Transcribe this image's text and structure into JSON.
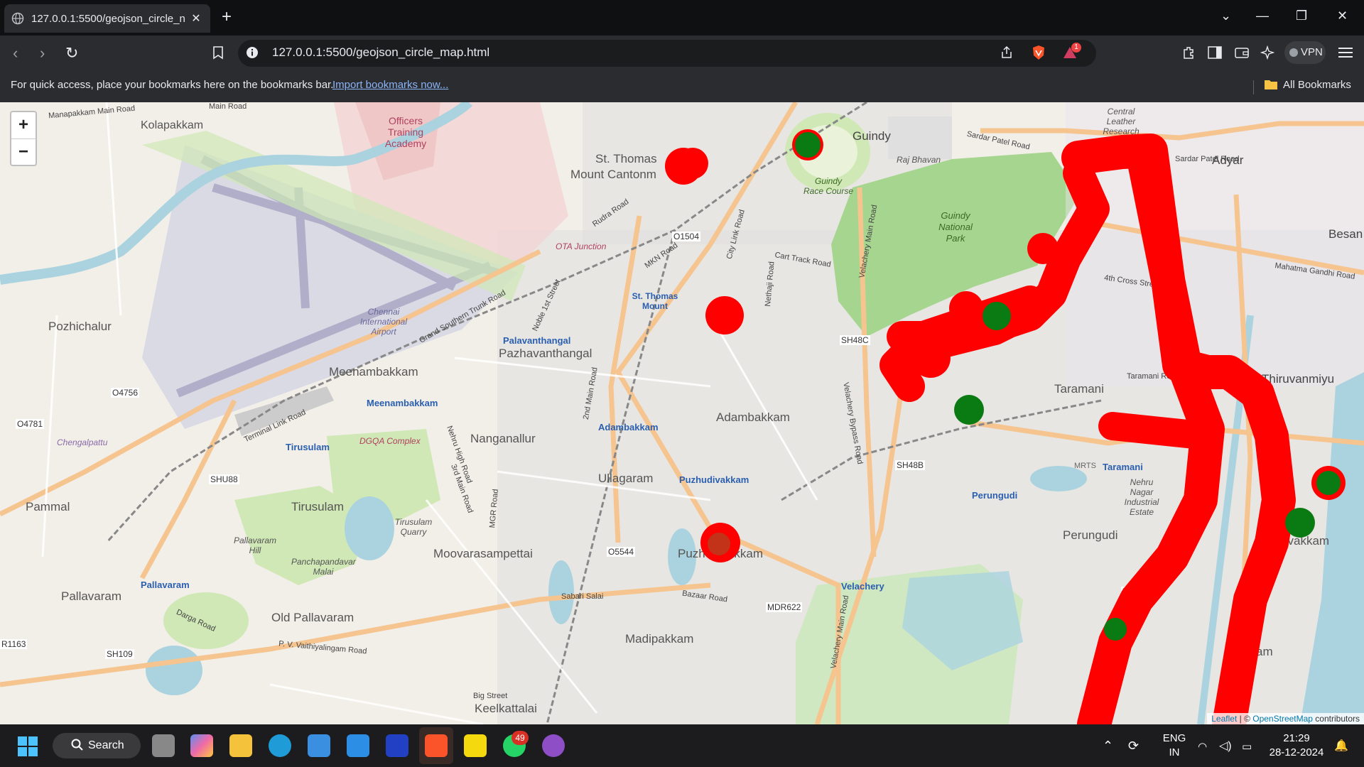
{
  "browser": {
    "tab_title": "127.0.0.1:5500/geojson_circle_n",
    "url": "127.0.0.1:5500/geojson_circle_map.html",
    "notification_count": "1",
    "vpn_label": "VPN"
  },
  "bookmarks_bar": {
    "message": "For quick access, place your bookmarks here on the bookmarks bar.",
    "import_link": "Import bookmarks now...",
    "all_bookmarks": "All Bookmarks"
  },
  "map": {
    "zoom_in": "+",
    "zoom_out": "−",
    "labels": {
      "officers": "Officers",
      "training": "Training",
      "academy": "Academy",
      "kolapakkam": "Kolapakkam",
      "guindy": "Guindy",
      "st_thomas_mount": "St. Thomas",
      "mount_cantonment": "Mount Cantonm",
      "raj_bhavan": "Raj Bhavan",
      "guindy_race": "Guindy",
      "race_course": "Race Course",
      "guindy_np1": "Guindy",
      "guindy_np2": "National",
      "guindy_np3": "Park",
      "central_leather": "Central",
      "central_leather2": "Leather",
      "central_leather3": "Research",
      "adyar": "Adyar",
      "besant": "Besan",
      "pozhichalur": "Pozhichalur",
      "chennai_airport1": "Chennai",
      "chennai_airport2": "International",
      "chennai_airport3": "Airport",
      "palavanthangal_station": "Palavanthangal",
      "pazhavanthangal": "Pazhavanthangal",
      "meenambakkam": "Meenambakkam",
      "meenambakkam_station": "Meenambakkam",
      "st_thomas_station1": "St. Thomas",
      "st_thomas_station2": "Mount",
      "o1504": "O1504",
      "ota_junction": "OTA Junction",
      "sh48c": "SH48C",
      "adambakkam_station": "Adambakkam",
      "adambakkam": "Adambakkam",
      "taramani": "Taramani",
      "thiruvanmiyur": "Thiruvanmiyu",
      "nanganallur": "Nanganallur",
      "o4756": "O4756",
      "o4781": "O4781",
      "chengalpattu": "Chengalpattu",
      "tirusulam_station": "Tirusulam",
      "dgqa": "DGQA Complex",
      "shu88": "SHU88",
      "ullagaram": "Ullagaram",
      "puzhudivakkam_station": "Puzhudivakkam",
      "sh48b": "SH48B",
      "perungudi_station": "Perungudi",
      "taramani_station": "Taramani",
      "mrts": "MRTS",
      "pammal": "Pammal",
      "tirusulam": "Tirusulam",
      "tirusulam_quarry1": "Tirusulam",
      "tirusulam_quarry2": "Quarry",
      "moovarasampettai": "Moovarasampettai",
      "o5544": "O5544",
      "puzhudivakkam": "Puzhudivakkam",
      "nehru_nagar1": "Nehru",
      "nehru_nagar2": "Nagar",
      "nehru_nagar3": "Industrial",
      "nehru_nagar4": "Estate",
      "perungudi": "Perungudi",
      "kottivakkam": "tivakkam",
      "pallavaram_hill1": "Pallavaram",
      "pallavaram_hill2": "Hill",
      "panchapandavar1": "Panchapandavar",
      "panchapandavar2": "Malai",
      "pallavaram_station": "Pallavaram",
      "pallavaram": "Pallavaram",
      "old_pallavaram": "Old Pallavaram",
      "velachery_station": "Velachery",
      "mdr622": "MDR622",
      "madipakkam": "Madipakkam",
      "sh109": "SH109",
      "r1163": "R1163",
      "keelkattalai": "Keelkattalai",
      "palli": "Pa",
      "am": "am",
      "md": "MD",
      "manapakkam_road": "Manapakkam Main Road",
      "main_road": "Main Road",
      "sardar_patel": "Sardar Patel Road",
      "sardar_patel2": "Sardar Patel Road",
      "gst_road": "Grand Southern Trunk Road",
      "velachery_main": "Velachery Main Road",
      "velachery_bypass": "Velachery Bypass Road",
      "cart_track": "Cart Track Road",
      "taramani_road": "Taramani Road",
      "fourth_cross": "4th Cross Stre",
      "mahatma_gandhi": "Mahatma Gandhi Road",
      "bazaar_road": "Bazaar Road",
      "sabari_salai": "Sabari Salai",
      "darga_road": "Darga Road",
      "vaithiyalingam": "P. V. Vaithiyalingam Road",
      "big_street": "Big Street",
      "terminal_link": "Terminal Link Road",
      "rudra_road": "Rudra Road",
      "mkn_road": "MKN Road",
      "city_link": "City Link Road",
      "nethaji": "Nethaji Road",
      "nehru_high": "Nehru High Road",
      "third_main": "3rd Main Road",
      "mgr_road": "MGR Road",
      "second_main": "2nd Main Road",
      "nobile": "Noble 1st Street"
    }
  },
  "attribution": {
    "leaflet": "Leaflet",
    "sep": " | © ",
    "osm": "OpenStreetMap",
    "contributors": " contributors"
  },
  "taskbar": {
    "search_label": "Search",
    "whatsapp_badge": "49",
    "lang_top": "ENG",
    "lang_bottom": "IN",
    "time": "21:29",
    "date": "28-12-2024"
  },
  "colors": {
    "route_red": "#ff0000",
    "marker_green": "#0a7a12",
    "park_green": "#a6d58f",
    "water_blue": "#aad3df",
    "airport_gray": "#c8c4d8"
  }
}
